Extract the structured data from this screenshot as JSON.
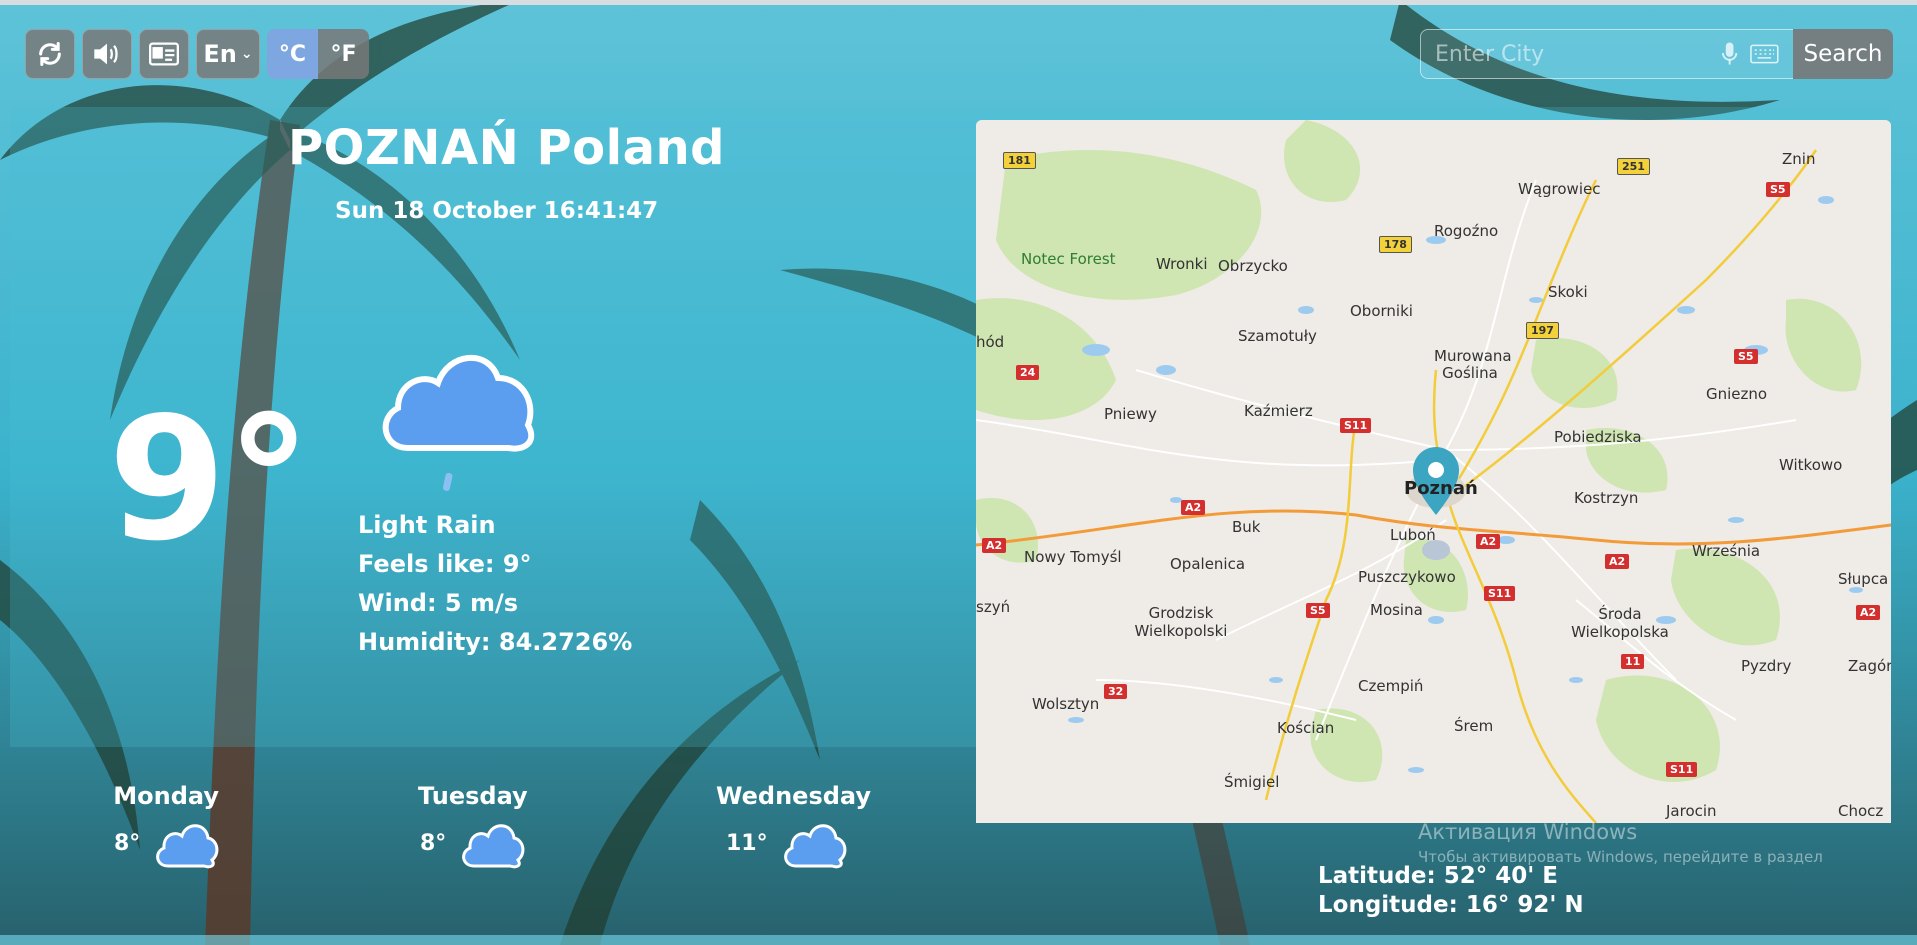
{
  "toolbar": {
    "refresh_icon": "refresh-icon",
    "sound_icon": "speaker-icon",
    "card_icon": "id-card-icon",
    "language": "En",
    "unit_c": "°C",
    "unit_f": "°F",
    "active_unit": "C"
  },
  "search": {
    "placeholder": "Enter City",
    "button_label": "Search",
    "mic_icon": "microphone-icon",
    "keyboard_icon": "keyboard-icon"
  },
  "weather": {
    "city": "POZNAŃ Poland",
    "datetime": "Sun 18 October  16:41:47",
    "temperature": "9°",
    "condition": "Light Rain",
    "feels_like": "Feels like: 9°",
    "wind": "Wind: 5 m/s",
    "humidity": "Humidity: 84.2726%",
    "icon": "rain-cloud-icon"
  },
  "forecast": [
    {
      "day": "Monday",
      "temp": "8°",
      "icon": "cloud-icon"
    },
    {
      "day": "Tuesday",
      "temp": "8°",
      "icon": "cloud-icon"
    },
    {
      "day": "Wednesday",
      "temp": "11°",
      "icon": "cloud-icon"
    }
  ],
  "map": {
    "places": [
      "Znin",
      "Wągrowiec",
      "Rogoźno",
      "Notec Forest",
      "Wronki",
      "Obrzycko",
      "Skoki",
      "Oborniki",
      "hód",
      "Szamotuły",
      "Murowana Goślina",
      "Gniezno",
      "Pniewy",
      "Kaźmierz",
      "Pobiedziska",
      "Witkowo",
      "Poznań",
      "Kostrzyn",
      "Buk",
      "Luboń",
      "Nowy Tomyśl",
      "Opalenica",
      "Września",
      "Puszczykowo",
      "Słupca",
      "szyń",
      "Grodzisk Wielkopolski",
      "Mosina",
      "Środa Wielkopolska",
      "Pyzdry",
      "Zagórów",
      "Czempiń",
      "Wolsztyn",
      "Kościan",
      "Śrem",
      "Śmigiel",
      "Jarocin",
      "Chocz"
    ],
    "road_shields": [
      "181",
      "251",
      "S5",
      "178",
      "197",
      "24",
      "S5",
      "S11",
      "A2",
      "A2",
      "A2",
      "A2",
      "A2",
      "S11",
      "S5",
      "11",
      "32",
      "S11",
      "A2"
    ]
  },
  "coords": {
    "latitude": "Latitude: 52° 40' E",
    "longitude": "Longitude: 16° 92' N"
  },
  "watermark": {
    "line1": "Активация Windows",
    "line2": "Чтобы активировать Windows, перейдите в раздел"
  },
  "colors": {
    "active_unit": "#7ea6e0",
    "button_bg": "#787878",
    "cloud": "#5b9ef0"
  }
}
